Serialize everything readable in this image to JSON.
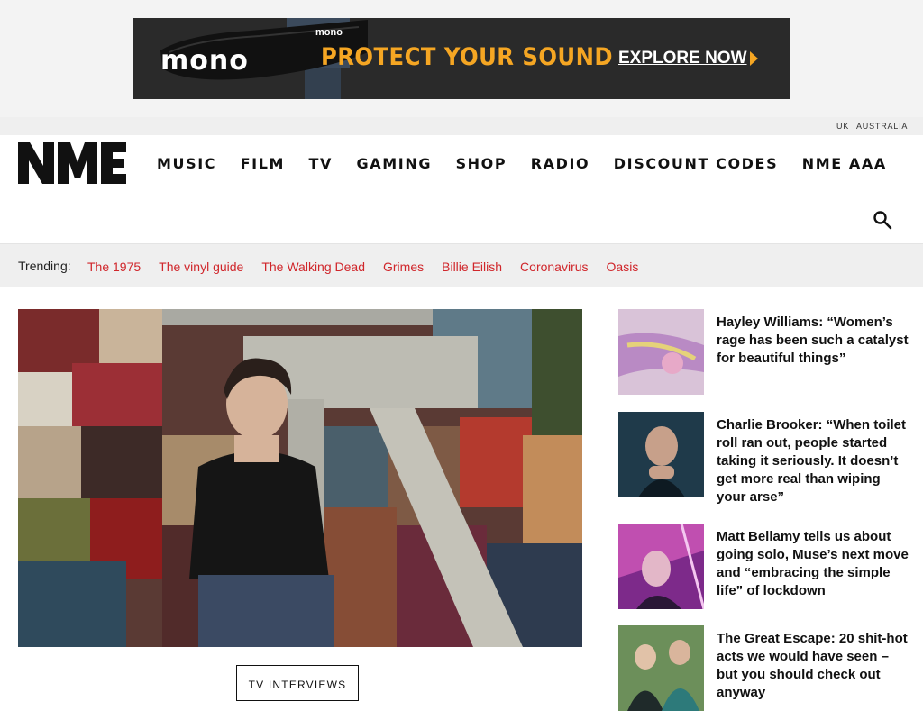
{
  "ad": {
    "brand": "mono",
    "small_brand": "mono",
    "tagline": "PROTECT YOUR SOUND",
    "cta": "EXPLORE NOW",
    "colors": {
      "background": "#2a2a2a",
      "accent": "#f5a623"
    }
  },
  "regions": [
    "UK",
    "AUSTRALIA"
  ],
  "header": {
    "logo": "NME",
    "nav": [
      "MUSIC",
      "FILM",
      "TV",
      "GAMING",
      "SHOP",
      "RADIO",
      "DISCOUNT CODES",
      "NME AAA"
    ],
    "search_icon": "search-icon"
  },
  "trending": {
    "label": "Trending:",
    "items": [
      "The 1975",
      "The vinyl guide",
      "The Walking Dead",
      "Grimes",
      "Billie Eilish",
      "Coronavirus",
      "Oasis"
    ],
    "link_color": "#d0262b"
  },
  "hero": {
    "tag": "TV INTERVIEWS"
  },
  "sidebar": [
    {
      "title": "Hayley Williams: “Women’s rage has been such a catalyst for beautiful things”"
    },
    {
      "title": "Charlie Brooker: “When toilet roll ran out, people started taking it seriously. It doesn’t get more real than wiping your arse”"
    },
    {
      "title": "Matt Bellamy tells us about going solo, Muse’s next move and “embracing the simple life” of lockdown"
    },
    {
      "title": "The Great Escape: 20 shit-hot acts we would have seen – but you should check out anyway"
    }
  ]
}
